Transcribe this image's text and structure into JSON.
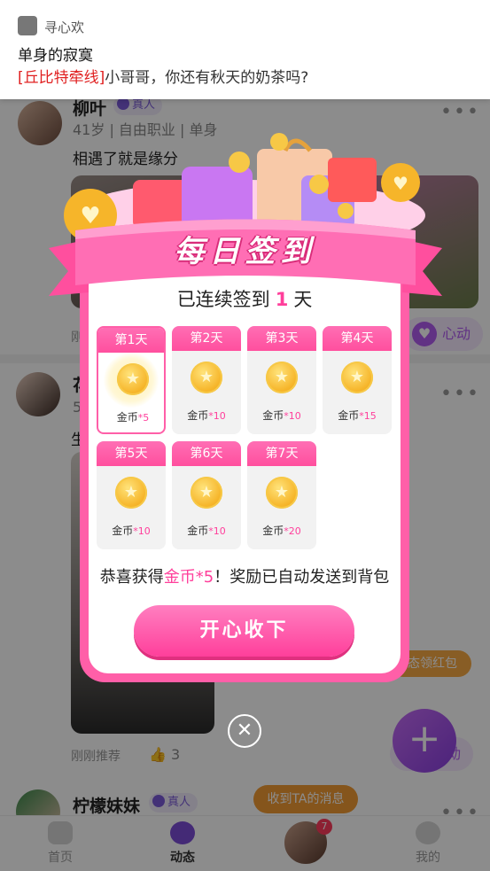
{
  "notification": {
    "app_name": "寻心欢",
    "title": "单身的寂寞",
    "highlight": "[丘比特牵线]",
    "body": "小哥哥，你还有秋天的奶茶吗?"
  },
  "feed": {
    "post1": {
      "name": "柳叶",
      "verified_label": "真人",
      "meta": "41岁 | 自由职业 | 单身",
      "text": "相遇了就是缘分",
      "recommend": "刚",
      "heart_label": "心动",
      "more": "•••"
    },
    "post2": {
      "name": "花",
      "meta": "5",
      "text": "生",
      "more": "•••",
      "recommend": "刚刚推荐",
      "likes": "3",
      "heart_label": "动",
      "hongbao_label": "态领红包"
    },
    "post3": {
      "name": "柠檬妹妹",
      "verified_label": "真人",
      "more": "•••"
    }
  },
  "bottom_nav": {
    "items": [
      {
        "label": "首页",
        "icon": "home-icon"
      },
      {
        "label": "动态",
        "icon": "moments-icon"
      },
      {
        "label": "",
        "icon": "avatar"
      },
      {
        "label": "我的",
        "icon": "profile-icon"
      }
    ],
    "message_pill": "收到TA的消息",
    "message_badge": "7",
    "fab_icon": "plus-icon"
  },
  "checkin": {
    "title": "每日签到",
    "streak_prefix": "已连续签到",
    "streak_days": "1",
    "streak_suffix": "天",
    "days": [
      {
        "label": "第1天",
        "reward_name": "金币",
        "amount": "*5",
        "today": true
      },
      {
        "label": "第2天",
        "reward_name": "金币",
        "amount": "*10"
      },
      {
        "label": "第3天",
        "reward_name": "金币",
        "amount": "*10"
      },
      {
        "label": "第4天",
        "reward_name": "金币",
        "amount": "*15"
      },
      {
        "label": "第5天",
        "reward_name": "金币",
        "amount": "*10"
      },
      {
        "label": "第6天",
        "reward_name": "金币",
        "amount": "*10"
      },
      {
        "label": "第7天",
        "reward_name": "金币",
        "amount": "*20"
      }
    ],
    "congrats_prefix": "恭喜获得",
    "congrats_reward": "金币*5",
    "congrats_suffix": "！奖励已自动发送到背包",
    "accept_label": "开心收下",
    "close_icon": "close-icon",
    "coin_icon": "gold-coin-icon"
  },
  "colors": {
    "accent_pink": "#ff3f9b",
    "card_border": "#ff5fa8",
    "purple": "#7d4ed8",
    "orange": "#f39c34"
  }
}
